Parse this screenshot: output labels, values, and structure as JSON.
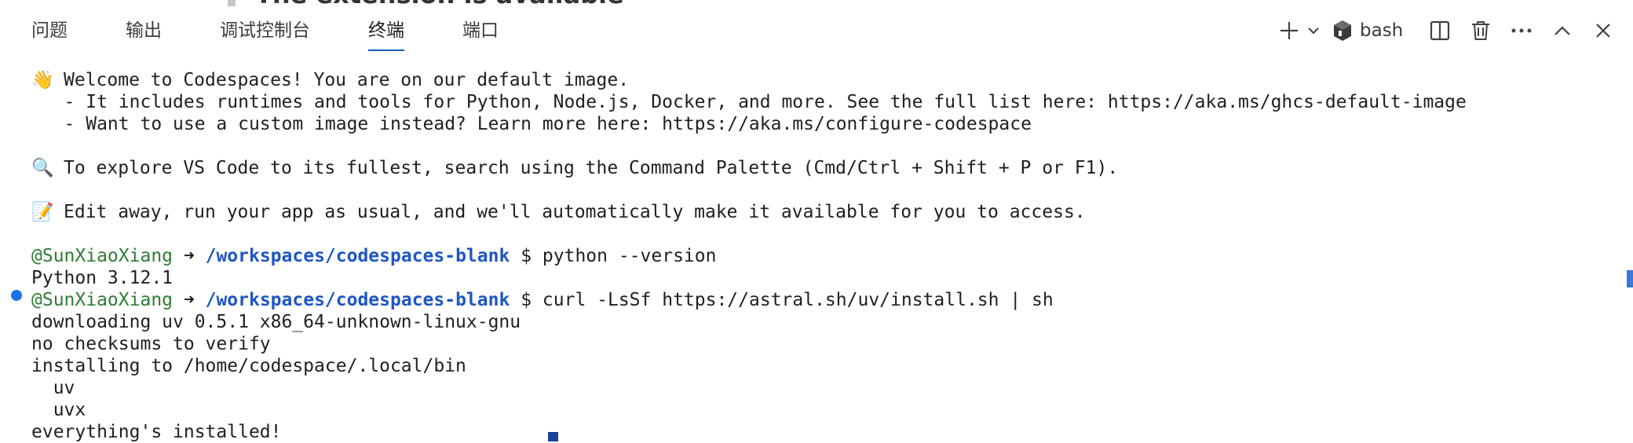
{
  "background_text": "The extension is available",
  "tabs": [
    {
      "label": "问题"
    },
    {
      "label": "输出"
    },
    {
      "label": "调试控制台"
    },
    {
      "label": "终端"
    },
    {
      "label": "端口"
    }
  ],
  "active_tab": "终端",
  "toolbar": {
    "new_terminal_icon": "plus-icon",
    "dropdown_icon": "chevron-down-icon",
    "shell_icon": "shell-icon",
    "shell_label": "bash",
    "split_icon": "split-icon",
    "kill_icon": "trash-icon",
    "more_icon": "ellipsis-icon",
    "maximize_icon": "chevron-up-icon",
    "close_icon": "close-icon"
  },
  "terminal": {
    "welcome": {
      "emoji": "👋",
      "line1": "Welcome to Codespaces! You are on our default image.",
      "line2": "   - It includes runtimes and tools for Python, Node.js, Docker, and more. See the full list here: https://aka.ms/ghcs-default-image",
      "line3": "   - Want to use a custom image instead? Learn more here: https://aka.ms/configure-codespace"
    },
    "explore": {
      "emoji": "🔍",
      "text": "To explore VS Code to its fullest, search using the Command Palette (Cmd/Ctrl + Shift + P or F1)."
    },
    "edit": {
      "emoji": "📝",
      "text": "Edit away, run your app as usual, and we'll automatically make it available for you to access."
    },
    "prompt_user": "@SunXiaoXiang",
    "prompt_arrow": "➜",
    "prompt_path": "/workspaces/codespaces-blank",
    "prompt_symbol": "$",
    "command1": "python --version",
    "output1": "Python 3.12.1",
    "command2": "curl -LsSf https://astral.sh/uv/install.sh | sh",
    "output2": [
      "downloading uv 0.5.1 x86_64-unknown-linux-gnu",
      "no checksums to verify",
      "installing to /home/codespace/.local/bin",
      "  uv",
      "  uvx",
      "everything's installed!"
    ]
  },
  "colors": {
    "user": "#2e7d32",
    "path": "#1e56c4",
    "accent": "#005fb8",
    "command_dot": "#1a73e8"
  }
}
